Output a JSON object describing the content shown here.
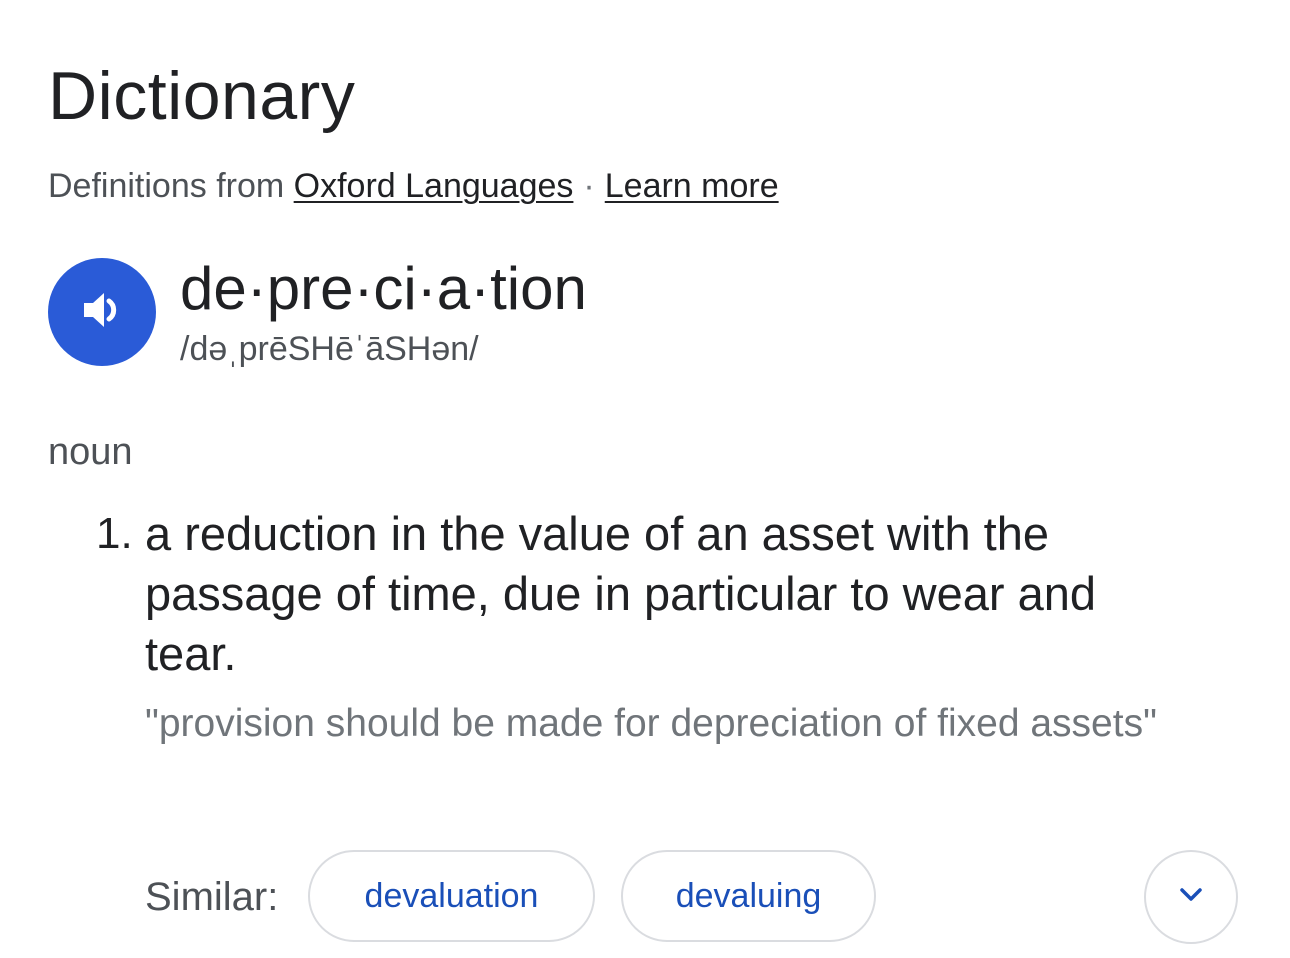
{
  "header": {
    "title": "Dictionary",
    "source_prefix": "Definitions from",
    "source_link": "Oxford Languages",
    "separator": "·",
    "learn_more": "Learn more"
  },
  "entry": {
    "word": "de·pre·ci·a·tion",
    "phonetic": "/dəˌprēSHēˈāSHən/",
    "audio_icon": "speaker-icon",
    "part_of_speech": "noun",
    "definitions": [
      {
        "number": "1.",
        "text": "a reduction in the value of an asset with the passage of time, due in particular to wear and tear.",
        "example": "\"provision should be made for depreciation of fixed assets\""
      }
    ]
  },
  "similar": {
    "label": "Similar:",
    "chips": [
      "devaluation",
      "devaluing"
    ],
    "expand_icon": "chevron-down-icon"
  },
  "colors": {
    "accent": "#2a5bd7",
    "chip_text": "#1a4fb8"
  }
}
